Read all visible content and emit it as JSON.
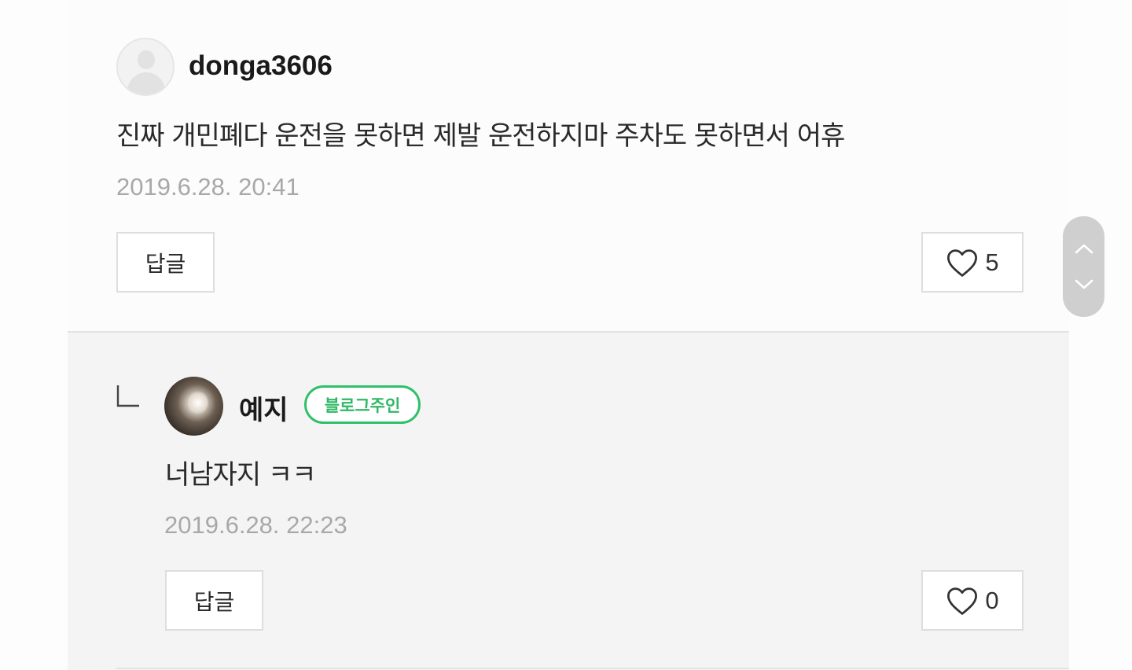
{
  "comment": {
    "username": "donga3606",
    "text": "진짜 개민폐다 운전을 못하면 제발 운전하지마 주차도 못하면서 어휴",
    "timestamp": "2019.6.28. 20:41",
    "reply_button_label": "답글",
    "like_count": "5",
    "avatar_icon": "default-user-avatar"
  },
  "reply": {
    "username": "예지",
    "badge": "블로그주인",
    "text": "너남자지 ㅋㅋ",
    "timestamp": "2019.6.28. 22:23",
    "reply_button_label": "답글",
    "like_count": "0",
    "avatar_icon": "profile-photo-avatar"
  },
  "icons": {
    "heart": "heart-outline-icon",
    "scroll_up": "chevron-up-icon",
    "scroll_down": "chevron-down-icon",
    "reply_indicator": "reply-corner-icon"
  },
  "colors": {
    "badge_green": "#2fc06a",
    "timestamp_gray": "#a8a8a8",
    "reply_background": "#f4f4f4"
  }
}
